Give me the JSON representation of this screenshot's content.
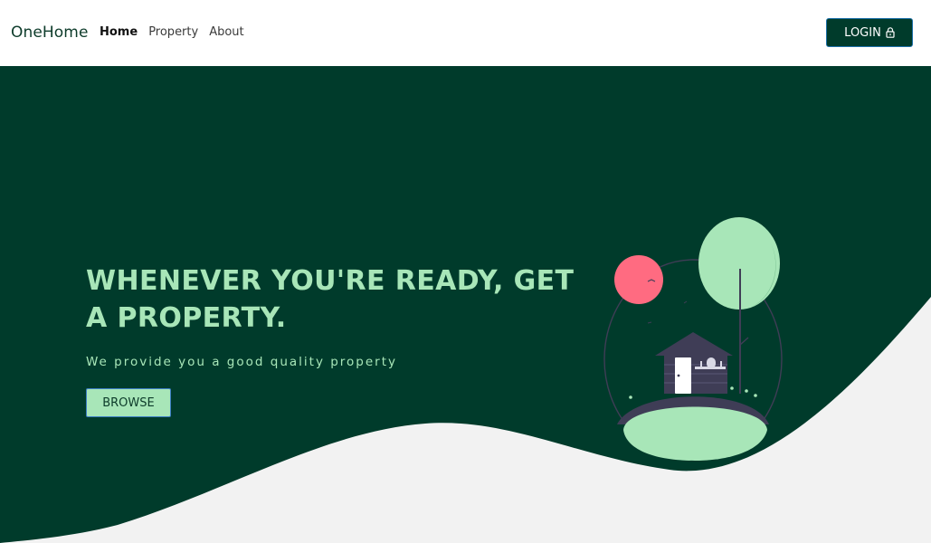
{
  "navbar": {
    "brand": "OneHome",
    "links": [
      {
        "label": "Home",
        "active": true
      },
      {
        "label": "Property",
        "active": false
      },
      {
        "label": "About",
        "active": false
      }
    ],
    "login_label": "LOGIN",
    "login_icon": "lock-icon"
  },
  "hero": {
    "headline": "WHENEVER YOU'RE READY, GET A PROPERTY.",
    "subtitle": "We provide you a good quality property",
    "browse_label": "BROWSE",
    "illustration_icon": "house-on-hill-illustration"
  },
  "colors": {
    "hero_bg": "#003b2b",
    "accent_green": "#a8e6b8",
    "page_bg": "#f2f2f2",
    "balloon_pink": "#ff6b81",
    "house_purple": "#3f3d56"
  }
}
